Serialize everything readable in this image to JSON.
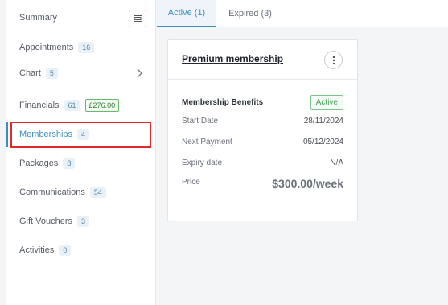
{
  "sidebar": {
    "items": [
      {
        "label": "Summary"
      },
      {
        "label": "Appointments",
        "count": "16"
      },
      {
        "label": "Chart",
        "count": "5"
      },
      {
        "label": "Financials",
        "count": "61",
        "amount": "£276.00"
      },
      {
        "label": "Memberships",
        "count": "4"
      },
      {
        "label": "Packages",
        "count": "8"
      },
      {
        "label": "Communications",
        "count": "54"
      },
      {
        "label": "Gift Vouchers",
        "count": "3"
      },
      {
        "label": "Activities",
        "count": "0"
      }
    ]
  },
  "tabs": [
    {
      "label": "Active (1)"
    },
    {
      "label": "Expired (3)"
    }
  ],
  "membership_card": {
    "title": "Premium membership",
    "benefits_label": "Membership Benefits",
    "status": "Active",
    "fields": [
      {
        "label": "Start Date",
        "value": "28/11/2024"
      },
      {
        "label": "Next Payment",
        "value": "05/12/2024"
      },
      {
        "label": "Expiry date",
        "value": "N/A"
      }
    ],
    "price_label": "Price",
    "price_value": "$300.00/week"
  },
  "icons": {
    "collapse": "collapse-sidebar-icon",
    "chevron": "chevron-right-icon",
    "more": "more-vertical-icon"
  },
  "colors": {
    "accent": "#3a8fbf",
    "highlight": "#e5262b",
    "active_green": "#3f9f52"
  }
}
